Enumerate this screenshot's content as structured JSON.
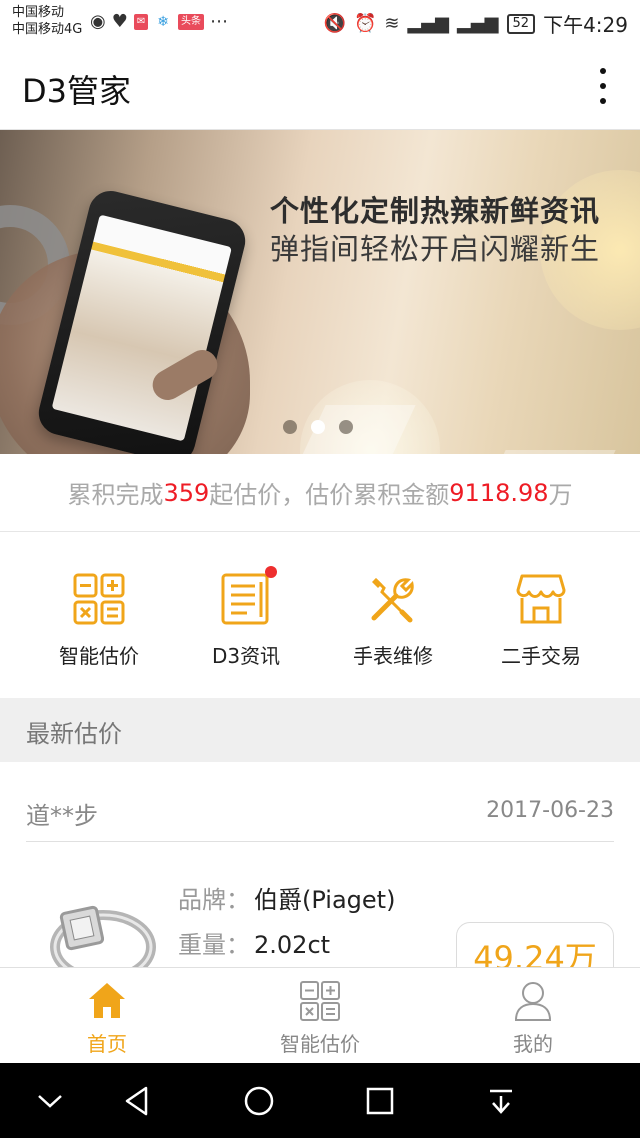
{
  "status_bar": {
    "carrier_1": "中国移动",
    "carrier_2": "中国移动4G",
    "badge_1": "头条",
    "battery": "52",
    "time": "下午4:29"
  },
  "app_bar": {
    "title": "D3管家"
  },
  "banner": {
    "line_1": "个性化定制热辣新鲜资讯",
    "line_2": "弹指间轻松开启闪耀新生",
    "slide_count": 3,
    "active_slide": 2
  },
  "stats": {
    "prefix": "累积完成",
    "count": "359",
    "middle": "起估价，估价累积金额",
    "amount": "9118.98",
    "suffix": "万"
  },
  "quick_menu": {
    "items": [
      {
        "label": "智能估价",
        "icon": "calculator-icon"
      },
      {
        "label": "D3资讯",
        "icon": "news-icon",
        "has_notification": true
      },
      {
        "label": "手表维修",
        "icon": "tools-icon"
      },
      {
        "label": "二手交易",
        "icon": "shop-icon"
      }
    ]
  },
  "latest": {
    "section_title": "最新估价",
    "record": {
      "user": "道**步",
      "date": "2017-06-23",
      "brand_label": "品牌：",
      "brand_value": "伯爵(Piaget)",
      "weight_label": "重量：",
      "weight_value": "2.02ct",
      "price": "49.24万"
    }
  },
  "tabbar": {
    "tabs": [
      {
        "label": "首页",
        "icon": "home-icon",
        "active": true
      },
      {
        "label": "智能估价",
        "icon": "calculator-icon",
        "active": false
      },
      {
        "label": "我的",
        "icon": "person-icon",
        "active": false
      }
    ]
  },
  "colors": {
    "accent": "#f0a51a",
    "highlight": "#ee1c25",
    "text_muted": "#a9a9a9"
  }
}
